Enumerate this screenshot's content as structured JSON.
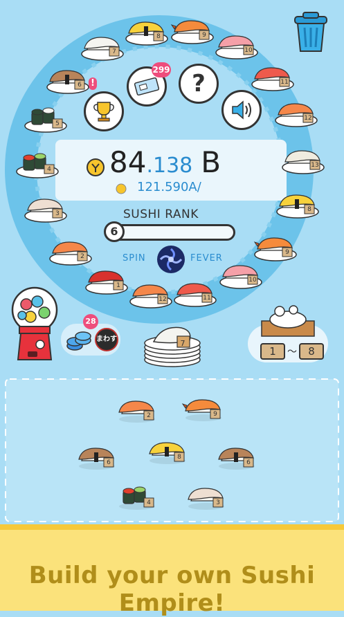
{
  "currency": {
    "main_integer": "84",
    "main_decimal": ".138",
    "main_unit": "B",
    "rate": "121.590A/"
  },
  "rank": {
    "title": "SUSHI RANK",
    "level": "6",
    "progress": 0.0
  },
  "spin": {
    "left_label": "SPIN",
    "right_label": "FEVER"
  },
  "ticket_badge": "299",
  "help_label": "?",
  "coins": {
    "badge": "28",
    "mawasu_label": "まわす"
  },
  "plate_stack_level": "7",
  "range_selector": {
    "from": "1",
    "separator": "～",
    "to": "8"
  },
  "ring_plates": [
    {
      "type": "tamago",
      "level": "8"
    },
    {
      "type": "shrimp",
      "level": "9"
    },
    {
      "type": "squid",
      "level": "7"
    },
    {
      "type": "tuna-pink",
      "level": "10"
    },
    {
      "type": "eel",
      "level": "6"
    },
    {
      "type": "tuna",
      "level": "11"
    },
    {
      "type": "maki",
      "level": "5"
    },
    {
      "type": "salmon",
      "level": "12"
    },
    {
      "type": "ikura",
      "level": "4"
    },
    {
      "type": "scallop",
      "level": "13"
    },
    {
      "type": "fish",
      "level": "3"
    },
    {
      "type": "tamago",
      "level": "8"
    },
    {
      "type": "salmon",
      "level": "2"
    },
    {
      "type": "shrimp",
      "level": "9"
    },
    {
      "type": "tuna-dark",
      "level": "1"
    },
    {
      "type": "tuna-pink",
      "level": "10"
    },
    {
      "type": "salmon",
      "level": "12"
    },
    {
      "type": "tuna",
      "level": "11"
    }
  ],
  "free_sushi": [
    {
      "type": "salmon",
      "level": "2"
    },
    {
      "type": "shrimp",
      "level": "9"
    },
    {
      "type": "eel",
      "level": "6"
    },
    {
      "type": "tamago",
      "level": "8"
    },
    {
      "type": "eel",
      "level": "6"
    },
    {
      "type": "ikura",
      "level": "4"
    },
    {
      "type": "fish",
      "level": "3"
    }
  ],
  "sushi_colors": {
    "tamago": "#f7d23c",
    "shrimp": "#f58b3c",
    "squid": "#f4f4f0",
    "tuna-pink": "#f5a0a8",
    "eel": "#b8845a",
    "tuna": "#ee5a4c",
    "maki": "#2f4a36",
    "salmon": "#f5874a",
    "ikura": "#e2402e",
    "scallop": "#f0ece0",
    "fish": "#eedfd2",
    "tuna-dark": "#d8322e"
  },
  "banner_text": "Build your own Sushi Empire!"
}
